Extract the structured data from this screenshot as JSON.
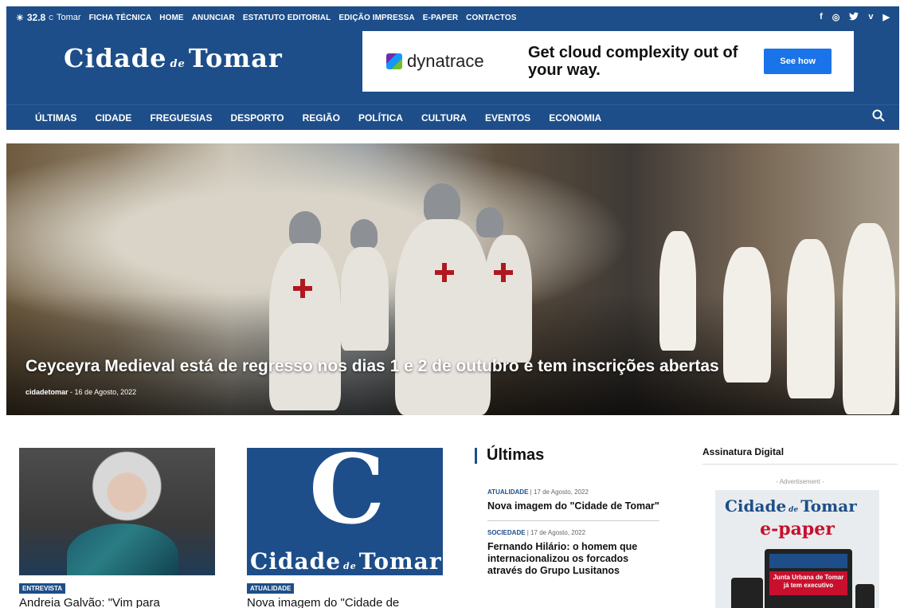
{
  "topbar": {
    "temperature": "32.8",
    "unit": "C",
    "city": "Tomar",
    "links": [
      "FICHA TÉCNICA",
      "HOME",
      "ANUNCIAR",
      "ESTATUTO EDITORIAL",
      "EDIÇÃO IMPRESSA",
      "E-PAPER",
      "CONTACTOS"
    ],
    "social_icons": [
      "facebook-icon",
      "instagram-icon",
      "twitter-icon",
      "vimeo-icon",
      "youtube-icon"
    ],
    "social_glyphs": [
      "f",
      "◎",
      "🐦",
      "v",
      "▶"
    ]
  },
  "logo": {
    "part1": "Cidade",
    "de": "de",
    "part2": "Tomar"
  },
  "ad": {
    "brand": "dynatrace",
    "headline": "Get cloud complexity out of your way.",
    "cta": "See how"
  },
  "nav": {
    "items": [
      "ÚLTIMAS",
      "CIDADE",
      "FREGUESIAS",
      "DESPORTO",
      "REGIÃO",
      "POLÍTICA",
      "CULTURA",
      "EVENTOS",
      "ECONOMIA"
    ],
    "search_glyph": "⚲"
  },
  "hero": {
    "title": "Ceyceyra Medieval está de regresso nos dias 1 e 2 de outubro e tem inscrições abertas",
    "author": "cidadetomar",
    "date": "16 de Agosto, 2022"
  },
  "cards": [
    {
      "badge": "ENTREVISTA",
      "title": "Andreia Galvão: \"Vim para"
    },
    {
      "badge": "ATUALIDADE",
      "title": "Nova imagem do \"Cidade de",
      "thumb_c": "C",
      "thumb_logo": "Cidade",
      "thumb_de": "de",
      "thumb_logo2": "Tomar"
    }
  ],
  "ultimas": {
    "heading": "Últimas",
    "entries": [
      {
        "category": "ATUALIDADE",
        "date": "17 de Agosto, 2022",
        "title": "Nova imagem do \"Cidade de Tomar\""
      },
      {
        "category": "SOCIEDADE",
        "date": "17 de Agosto, 2022",
        "title": "Fernando Hilário: o homem que internacionalizou os forcados através do Grupo Lusitanos"
      }
    ]
  },
  "sidebar": {
    "title": "Assinatura Digital",
    "ad_label": "- Advertisement -",
    "epaper_logo": "Cidade",
    "epaper_de": "de",
    "epaper_logo2": "Tomar",
    "epaper_tag": "e-paper",
    "paper_headline": "Junta Urbana de Tomar já tem executivo"
  },
  "colors": {
    "brand_blue": "#1d4e89",
    "accent_red": "#c8102e",
    "cta_blue": "#1a73e8"
  }
}
